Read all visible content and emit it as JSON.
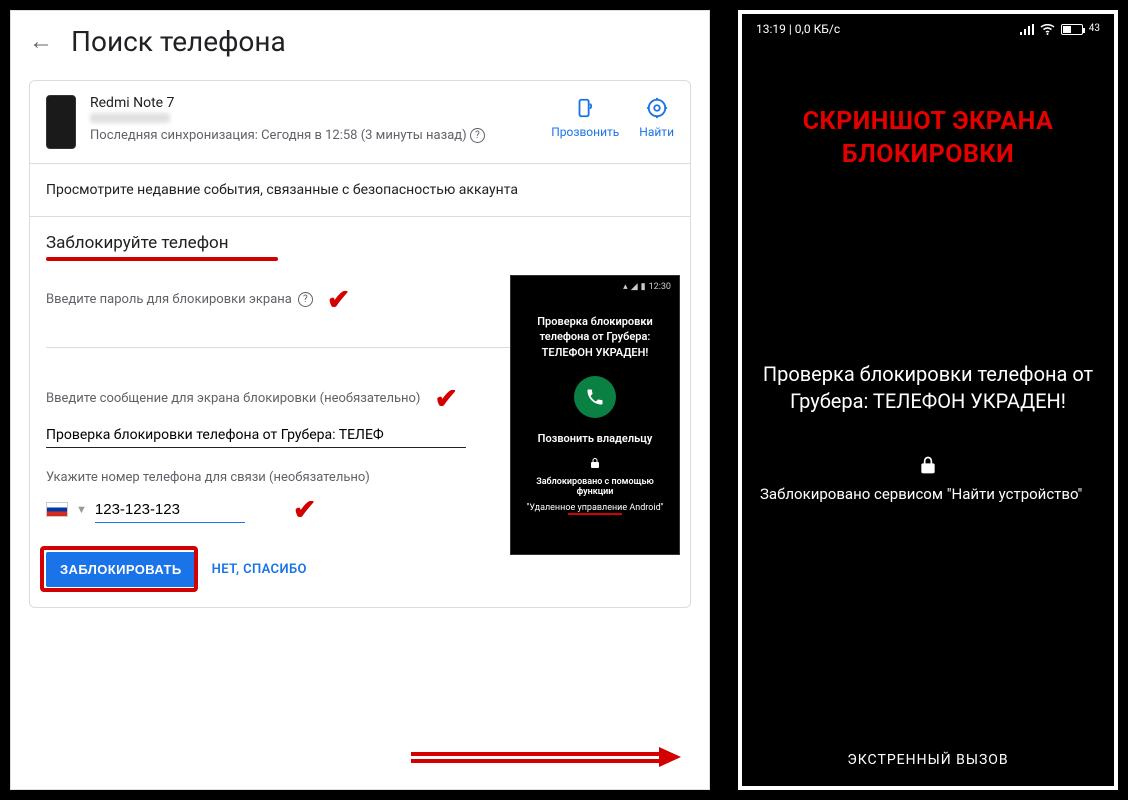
{
  "header": {
    "title": "Поиск телефона"
  },
  "device": {
    "name": "Redmi Note 7",
    "sync": "Последняя синхронизация: Сегодня в 12:58 (3 минуты назад)",
    "actions": {
      "ring": "Прозвонить",
      "find": "Найти"
    }
  },
  "security_notice": "Просмотрите недавние события, связанные с безопасностью аккаунта",
  "lock": {
    "heading": "Заблокируйте телефон",
    "pw_label": "Введите пароль для блокировки экрана",
    "msg_label": "Введите сообщение для экрана блокировки (необязательно)",
    "msg_value": "Проверка блокировки телефона от Грубера: ТЕЛЕФ",
    "phone_label": "Укажите номер телефона для связи (необязательно)",
    "phone_value": "123-123-123",
    "lock_btn": "ЗАБЛОКИРОВАТЬ",
    "no_thanks": "НЕТ, СПАСИБО"
  },
  "preview_small": {
    "time": "12:30",
    "msg": "Проверка блокировки телефона от Грубера: ТЕЛЕФОН УКРАДЕН!",
    "call_owner": "Позвонить владельцу",
    "foot1": "Заблокировано с помощью функции",
    "foot2": "\"Удаленное управление Android\""
  },
  "right": {
    "status_left": "13:19 | 0,0 КБ/с",
    "batt_level": "43",
    "overlay_title": "СКРИНШОТ ЭКРАНА БЛОКИРОВКИ",
    "msg": "Проверка блокировки телефона от Грубера: ТЕЛЕФОН УКРАДЕН!",
    "sub": "Заблокировано сервисом \"Найти устройство\"",
    "emergency": "ЭКСТРЕННЫЙ ВЫЗОВ"
  }
}
